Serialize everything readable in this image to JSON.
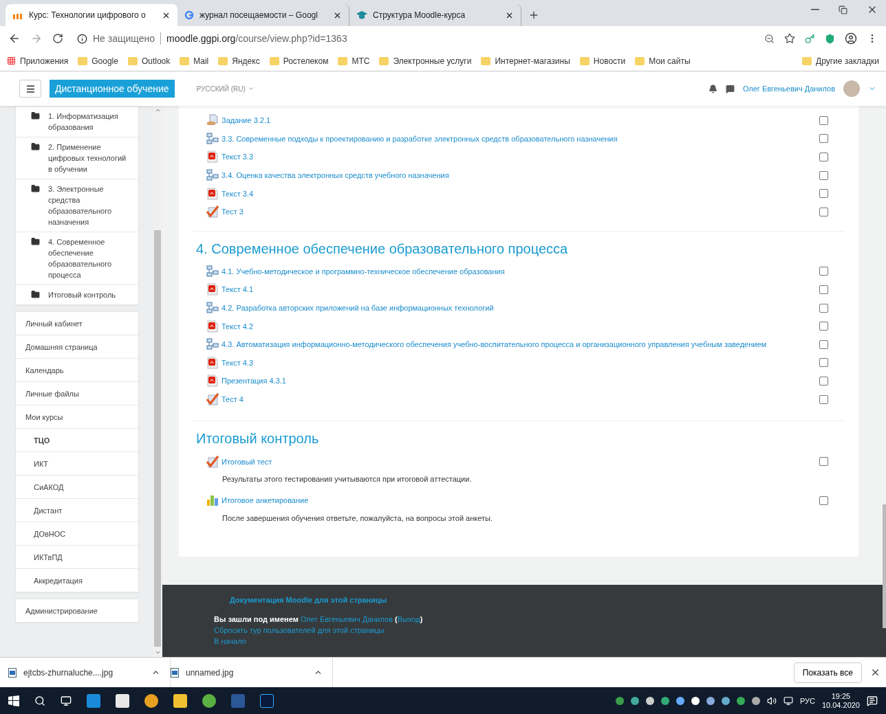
{
  "browser": {
    "tabs": [
      {
        "title": "Курс: Технологии цифрового о",
        "selected": true,
        "kind": "moodle"
      },
      {
        "title": "журнал посещаемости – Googl",
        "selected": false,
        "kind": "google"
      },
      {
        "title": "Структура Moodle-курса",
        "selected": false,
        "kind": "cap"
      }
    ],
    "address": {
      "security": "Не защищено",
      "host": "moodle.ggpi.org",
      "path": "/course/view.php?id=1363"
    },
    "bookmarks": {
      "apps": "Приложения",
      "items": [
        "Google",
        "Outlook",
        "Mail",
        "Яндекс",
        "Ростелеком",
        "МТС",
        "Электронные услуги",
        "Интернет-магазины",
        "Новости",
        "Мои сайты"
      ],
      "other": "Другие закладки"
    }
  },
  "navbar": {
    "brand": "Дистанционное обучение",
    "language": "РУССКИЙ (RU)",
    "user": "Олег Евгеньевич Данилов"
  },
  "sidebar": {
    "sections": [
      "1. Информатизация образования",
      "2. Применение цифровых технологий в обучении",
      "3. Электронные средства образовательного назначения",
      "4. Современное обеспечение образовательного процесса",
      "Итоговый контроль"
    ],
    "nav": [
      {
        "label": "Личный кабинет"
      },
      {
        "label": "Домашняя страница"
      },
      {
        "label": "Календарь"
      },
      {
        "label": "Личные файлы"
      },
      {
        "label": "Мои курсы",
        "children": [
          {
            "label": "ТЦО",
            "selected": true
          },
          {
            "label": "ИКТ",
            "selected": false
          },
          {
            "label": "СиАКОД",
            "selected": false
          },
          {
            "label": "Дистант",
            "selected": false
          },
          {
            "label": "ДОвНОС",
            "selected": false
          },
          {
            "label": "ИКТвПД",
            "selected": false
          },
          {
            "label": "Аккредитация",
            "selected": false
          }
        ]
      }
    ],
    "admin": "Администрирование"
  },
  "course": {
    "sections": [
      {
        "activities": [
          {
            "kind": "assign",
            "label": "Задание 3.2.1",
            "checked": false
          },
          {
            "kind": "page",
            "label": "3.3. Современные подходы к проектированию и разработке электронных средств образовательного назначения",
            "checked": false
          },
          {
            "kind": "pdf",
            "label": "Текст 3.3",
            "checked": false
          },
          {
            "kind": "page",
            "label": "3.4. Оценка качества электронных средств учебного назначения",
            "checked": false
          },
          {
            "kind": "pdf",
            "label": "Текст 3.4",
            "checked": false
          },
          {
            "kind": "quiz",
            "label": "Тест 3",
            "checked": false
          }
        ]
      },
      {
        "title": "4. Современное обеспечение образовательного процесса",
        "activities": [
          {
            "kind": "page",
            "label": "4.1. Учебно-методическое и программно-техническое обеспечение образования",
            "checked": false
          },
          {
            "kind": "pdf",
            "label": "Текст 4.1",
            "checked": false
          },
          {
            "kind": "page",
            "label": "4.2. Разработка авторских приложений на базе информационных технологий",
            "checked": false
          },
          {
            "kind": "pdf",
            "label": "Текст 4.2",
            "checked": false
          },
          {
            "kind": "page",
            "label": "4.3. Автоматизация информационно-методического обеспечения учебно-воспитательного процесса и организационного управления учебным заведением",
            "checked": false
          },
          {
            "kind": "pdf",
            "label": "Текст 4.3",
            "checked": false
          },
          {
            "kind": "pdf",
            "label": "Презентация 4.3.1",
            "checked": false
          },
          {
            "kind": "quiz",
            "label": "Тест 4",
            "checked": false
          }
        ]
      },
      {
        "title": "Итоговый контроль",
        "activities": [
          {
            "kind": "quiz",
            "label": "Итоговый тест",
            "description": "Результаты этого тестирования учитываются при итоговой аттестации.",
            "checked": false
          },
          {
            "kind": "feedback",
            "label": "Итоговое анкетирование",
            "description": "После завершения обучения ответьте, пожалуйста, на вопросы этой анкеты.",
            "checked": false
          }
        ]
      }
    ]
  },
  "footer": {
    "docs": "Документация Moodle для этой страницы",
    "logged_prefix": "Вы зашли под именем",
    "logged_user": "Олег Евгеньевич Данилов",
    "paren_open": "(",
    "logout": "Выход",
    "paren_close": ")",
    "reset_tour": "Сбросить тур пользователей для этой страницы",
    "home": "В начало"
  },
  "downloads": {
    "files": [
      "ejtcbs-zhurnaluche....jpg",
      "unnamed.jpg"
    ],
    "show_all": "Показать все"
  },
  "taskbar": {
    "language": "РУС",
    "time": "19:25",
    "date": "10.04.2020"
  }
}
